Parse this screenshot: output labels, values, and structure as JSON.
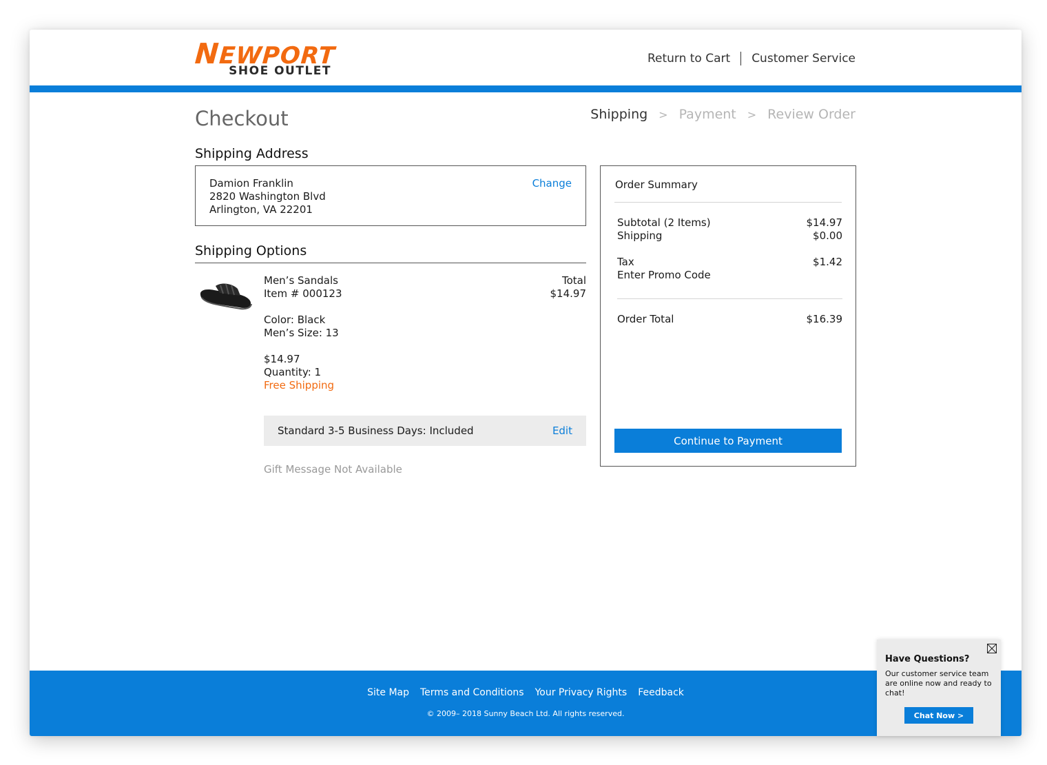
{
  "brand": {
    "name_first_letter": "N",
    "name_rest": "EWPORT",
    "tagline": "SHOE OUTLET",
    "accent_color": "#f26a10",
    "primary_color": "#0a7ed9"
  },
  "header": {
    "return_to_cart": "Return to Cart",
    "customer_service": "Customer Service"
  },
  "page": {
    "title": "Checkout"
  },
  "steps": [
    {
      "label": "Shipping",
      "active": true
    },
    {
      "label": "Payment",
      "active": false
    },
    {
      "label": "Review Order",
      "active": false
    }
  ],
  "step_separator": ">",
  "shipping_address": {
    "heading": "Shipping Address",
    "name": "Damion Franklin",
    "street": "2820 Washington Blvd",
    "city_state_zip": "Arlington, VA 22201",
    "change_label": "Change"
  },
  "shipping_options": {
    "heading": "Shipping Options",
    "item": {
      "icon": "sandal-product-image",
      "name": "Men’s Sandals",
      "item_number": "Item # 000123",
      "color": "Color: Black",
      "size": "Men’s Size: 13",
      "price": "$14.97",
      "quantity": "Quantity: 1",
      "shipping_note": "Free Shipping",
      "total_label": "Total",
      "total_value": "$14.97"
    },
    "method": {
      "label": "Standard 3-5 Business Days: Included",
      "edit_label": "Edit"
    },
    "gift_message": "Gift Message Not Available"
  },
  "order_summary": {
    "title": "Order Summary",
    "subtotal_label": "Subtotal (2 Items)",
    "subtotal_value": "$14.97",
    "shipping_label": "Shipping",
    "shipping_value": "$0.00",
    "tax_label": "Tax",
    "tax_value": "$1.42",
    "promo_label": "Enter Promo Code",
    "total_label": "Order Total",
    "total_value": "$16.39",
    "continue_button": "Continue to Payment"
  },
  "footer": {
    "links": [
      "Site Map",
      "Terms and Conditions",
      "Your Privacy Rights",
      "Feedback"
    ],
    "copyright": "© 2009– 2018 Sunny Beach Ltd. All rights reserved."
  },
  "chat_widget": {
    "title": "Have Questions?",
    "body": "Our customer service team are online now and ready to chat!",
    "button": "Chat Now >"
  }
}
